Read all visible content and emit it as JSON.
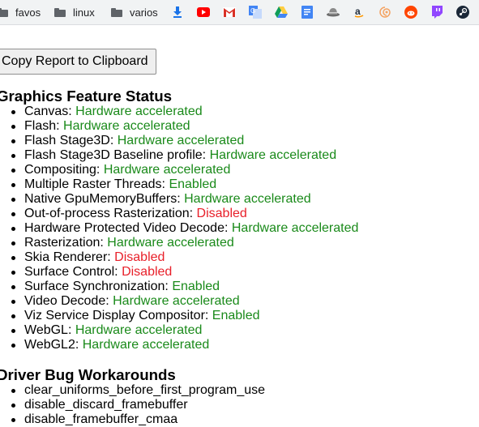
{
  "bookmarks": {
    "folders": [
      {
        "label": "favos"
      },
      {
        "label": "linux"
      },
      {
        "label": "varios"
      }
    ],
    "icons": [
      {
        "name": "download-icon",
        "color": "#1a73e8"
      },
      {
        "name": "youtube-icon",
        "color": "#ff0000"
      },
      {
        "name": "gmail-icon",
        "color": "#d93025"
      },
      {
        "name": "translate-icon",
        "color": "#4285f4"
      },
      {
        "name": "drive-icon",
        "color": "#0f9d58"
      },
      {
        "name": "docs-icon",
        "color": "#4285f4"
      },
      {
        "name": "hat-icon",
        "color": "#6b6b6b"
      },
      {
        "name": "amazon-icon",
        "color": "#232f3e"
      },
      {
        "name": "swirl-icon",
        "color": "#f4a261"
      },
      {
        "name": "reddit-icon",
        "color": "#ff4500"
      },
      {
        "name": "twitch-icon",
        "color": "#9146ff"
      },
      {
        "name": "steam-icon",
        "color": "#1b2838"
      }
    ]
  },
  "report": {
    "copy_label": "Copy Report to Clipboard"
  },
  "graphics_status": {
    "heading": "Graphics Feature Status",
    "items": [
      {
        "label": "Canvas: ",
        "value": "Hardware accelerated",
        "status": "ok"
      },
      {
        "label": "Flash: ",
        "value": "Hardware accelerated",
        "status": "ok"
      },
      {
        "label": "Flash Stage3D: ",
        "value": "Hardware accelerated",
        "status": "ok"
      },
      {
        "label": "Flash Stage3D Baseline profile: ",
        "value": "Hardware accelerated",
        "status": "ok"
      },
      {
        "label": "Compositing: ",
        "value": "Hardware accelerated",
        "status": "ok"
      },
      {
        "label": "Multiple Raster Threads: ",
        "value": "Enabled",
        "status": "ok"
      },
      {
        "label": "Native GpuMemoryBuffers: ",
        "value": "Hardware accelerated",
        "status": "ok"
      },
      {
        "label": "Out-of-process Rasterization: ",
        "value": "Disabled",
        "status": "bad"
      },
      {
        "label": "Hardware Protected Video Decode: ",
        "value": "Hardware accelerated",
        "status": "ok"
      },
      {
        "label": "Rasterization: ",
        "value": "Hardware accelerated",
        "status": "ok"
      },
      {
        "label": "Skia Renderer: ",
        "value": "Disabled",
        "status": "bad"
      },
      {
        "label": "Surface Control: ",
        "value": "Disabled",
        "status": "bad"
      },
      {
        "label": "Surface Synchronization: ",
        "value": "Enabled",
        "status": "ok"
      },
      {
        "label": "Video Decode: ",
        "value": "Hardware accelerated",
        "status": "ok"
      },
      {
        "label": "Viz Service Display Compositor: ",
        "value": "Enabled",
        "status": "ok"
      },
      {
        "label": "WebGL: ",
        "value": "Hardware accelerated",
        "status": "ok"
      },
      {
        "label": "WebGL2: ",
        "value": "Hardware accelerated",
        "status": "ok"
      }
    ]
  },
  "workarounds": {
    "heading": "Driver Bug Workarounds",
    "items": [
      "clear_uniforms_before_first_program_use",
      "disable_discard_framebuffer",
      "disable_framebuffer_cmaa"
    ]
  },
  "colors": {
    "enabled": "#1a8a1a",
    "disabled": "#e8202a"
  }
}
